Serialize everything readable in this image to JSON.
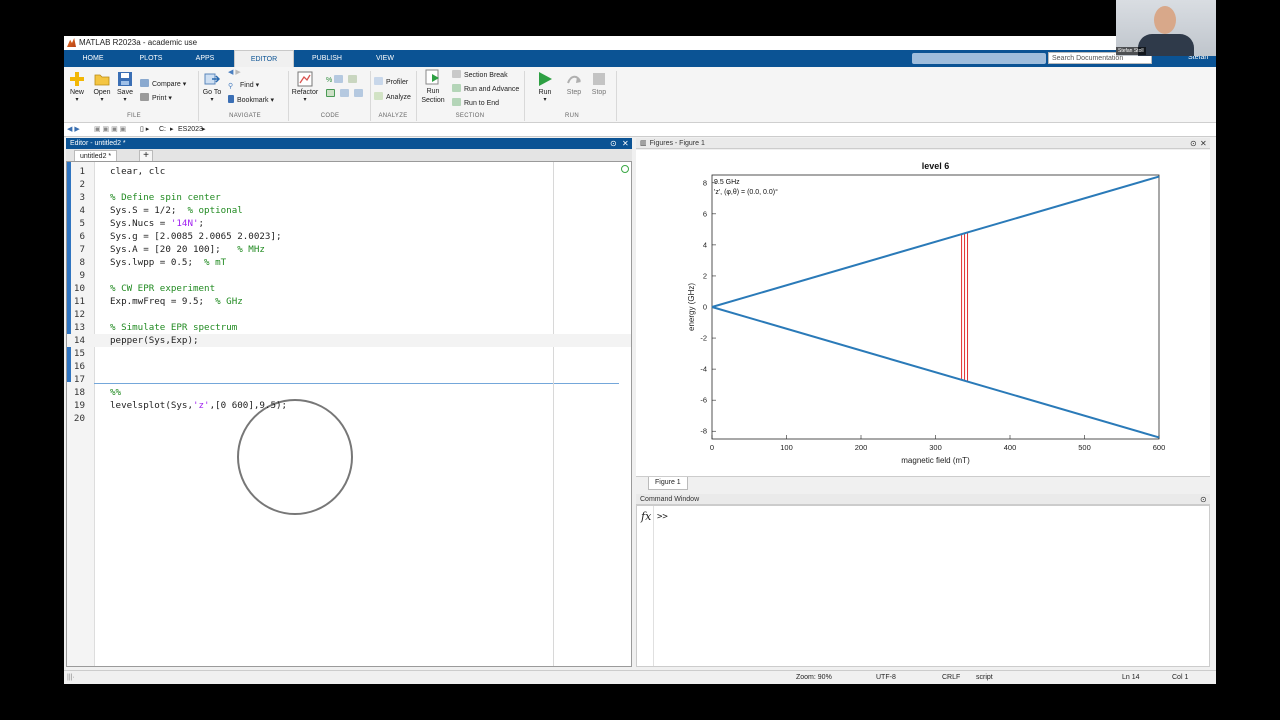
{
  "window": {
    "title": "MATLAB R2023a - academic use"
  },
  "main_tabs": [
    "HOME",
    "PLOTS",
    "APPS",
    "EDITOR",
    "PUBLISH",
    "VIEW"
  ],
  "active_tab": "EDITOR",
  "search": {
    "placeholder": "Search Documentation"
  },
  "user": "Stefan",
  "ribbon": {
    "file": {
      "label": "FILE",
      "new": "New",
      "open": "Open",
      "save": "Save",
      "compare": "Compare",
      "print": "Print"
    },
    "navigate": {
      "label": "NAVIGATE",
      "goto": "Go To",
      "find": "Find",
      "bookmark": "Bookmark"
    },
    "code": {
      "label": "CODE",
      "refactor": "Refactor"
    },
    "analyze": {
      "label": "ANALYZE",
      "profiler": "Profiler",
      "analyze": "Analyze"
    },
    "section": {
      "label": "SECTION",
      "run_section": "Run Section",
      "section_break": "Section Break",
      "run_advance": "Run and Advance",
      "run_end": "Run to End"
    },
    "run": {
      "label": "RUN",
      "run": "Run",
      "step": "Step",
      "stop": "Stop"
    }
  },
  "address": {
    "drive": "C:",
    "folder": "ES2023"
  },
  "editor": {
    "title": "Editor - untitled2 *",
    "tab": "untitled2 *",
    "current_line": 14,
    "lines": [
      {
        "n": "1",
        "code": "clear, clc"
      },
      {
        "n": "2",
        "code": ""
      },
      {
        "n": "3",
        "code": "% Define spin center"
      },
      {
        "n": "4",
        "code": "Sys.S = 1/2;  % optional"
      },
      {
        "n": "5",
        "code": "Sys.Nucs = '14N';"
      },
      {
        "n": "6",
        "code": "Sys.g = [2.0085 2.0065 2.0023];"
      },
      {
        "n": "7",
        "code": "Sys.A = [20 20 100];   % MHz"
      },
      {
        "n": "8",
        "code": "Sys.lwpp = 0.5;  % mT"
      },
      {
        "n": "9",
        "code": ""
      },
      {
        "n": "10",
        "code": "% CW EPR experiment"
      },
      {
        "n": "11",
        "code": "Exp.mwFreq = 9.5;  % GHz"
      },
      {
        "n": "12",
        "code": ""
      },
      {
        "n": "13",
        "code": "% Simulate EPR spectrum"
      },
      {
        "n": "14",
        "code": "pepper(Sys,Exp);"
      },
      {
        "n": "15",
        "code": ""
      },
      {
        "n": "16",
        "code": ""
      },
      {
        "n": "17",
        "code": ""
      },
      {
        "n": "18",
        "code": "%%"
      },
      {
        "n": "19",
        "code": "levelsplot(Sys,'z',[0 600],9.5);"
      },
      {
        "n": "20",
        "code": ""
      }
    ]
  },
  "figures": {
    "title": "Figures - Figure 1",
    "tab": "Figure 1"
  },
  "command_window": {
    "title": "Command Window",
    "prompt": ">>",
    "fx": "fx"
  },
  "status": {
    "zoom": "Zoom: 90%",
    "encoding": "UTF-8",
    "eol": "CRLF",
    "type": "script",
    "ln": "Ln  14",
    "col": "Col  1"
  },
  "webcam": {
    "name": "Stefan Stoll"
  },
  "colors": {
    "accent": "#0b5394",
    "series": "#2a7ab8",
    "transition": "#e03030",
    "comment": "#228b22",
    "string": "#a020f0"
  },
  "chart_data": {
    "type": "line",
    "title": "level 6",
    "xlabel": "magnetic field (mT)",
    "ylabel": "energy (GHz)",
    "xlim": [
      0,
      600
    ],
    "ylim": [
      -8.5,
      8.5
    ],
    "xticks": [
      0,
      100,
      200,
      300,
      400,
      500,
      600
    ],
    "yticks": [
      -8,
      -6,
      -4,
      -2,
      0,
      2,
      4,
      6,
      8
    ],
    "annotations": [
      "9.5 GHz",
      "'z',  (φ,θ) = (0.0, 0.0)°"
    ],
    "series": [
      {
        "x": [
          0,
          600
        ],
        "values": [
          0,
          8.4
        ]
      },
      {
        "x": [
          0,
          600
        ],
        "values": [
          0,
          -8.4
        ]
      }
    ],
    "transitions": [
      {
        "x": 335,
        "y0": -4.7,
        "y1": 4.7
      },
      {
        "x": 339,
        "y0": -4.75,
        "y1": 4.75
      },
      {
        "x": 343,
        "y0": -4.8,
        "y1": 4.8
      }
    ],
    "grid": false
  }
}
